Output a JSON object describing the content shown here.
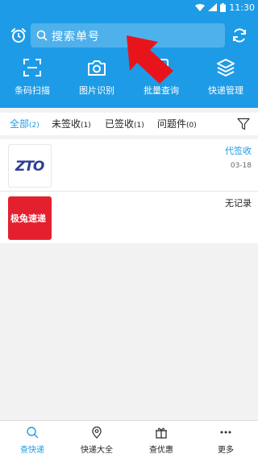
{
  "status_bar": {
    "time": "11:30"
  },
  "search": {
    "placeholder": "搜索单号"
  },
  "tools": [
    {
      "label": "条码扫描",
      "icon": "barcode-scan-icon"
    },
    {
      "label": "图片识别",
      "icon": "camera-icon"
    },
    {
      "label": "批量查询",
      "icon": "batch-query-icon"
    },
    {
      "label": "快递管理",
      "icon": "layers-icon"
    }
  ],
  "tabs": [
    {
      "label": "全部",
      "count": "(2)",
      "active": true
    },
    {
      "label": "未签收",
      "count": "(1)",
      "active": false
    },
    {
      "label": "已签收",
      "count": "(1)",
      "active": false
    },
    {
      "label": "问题件",
      "count": "(0)",
      "active": false
    }
  ],
  "packages": [
    {
      "logo_text": "ZTO",
      "status": "代签收",
      "date": "03-18"
    },
    {
      "logo_text": "极兔速递",
      "status": "无记录",
      "date": ""
    }
  ],
  "bottom_nav": [
    {
      "label": "查快递",
      "icon": "search-icon",
      "active": true
    },
    {
      "label": "快递大全",
      "icon": "location-pin-icon",
      "active": false
    },
    {
      "label": "查优惠",
      "icon": "gift-icon",
      "active": false
    },
    {
      "label": "更多",
      "icon": "more-icon",
      "active": false
    }
  ],
  "colors": {
    "primary": "#1e9be6",
    "annotation_arrow": "#e8141c",
    "jt_red": "#e5202e",
    "zto_blue": "#2c3e95"
  }
}
